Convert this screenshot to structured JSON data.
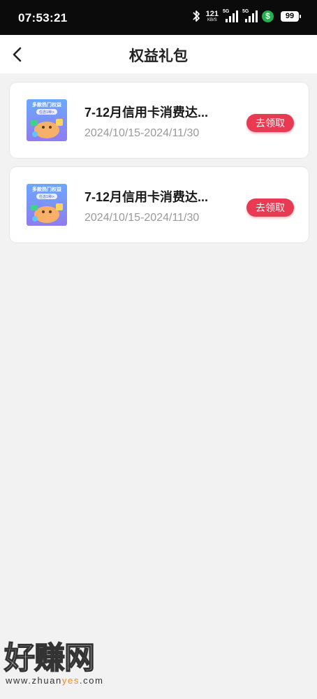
{
  "status_bar": {
    "time": "07:53:21",
    "net_speed_value": "121",
    "net_speed_unit": "KB/S",
    "sim1_label": "5G",
    "sim2_label": "5G",
    "battery": "99"
  },
  "header": {
    "title": "权益礼包"
  },
  "items": [
    {
      "thumb_text_1": "多款热门权益",
      "thumb_text_2": "任选1种>",
      "title": "7-12月信用卡消费达...",
      "date_range": "2024/10/15-2024/11/30",
      "button_label": "去领取"
    },
    {
      "thumb_text_1": "多款热门权益",
      "thumb_text_2": "任选1种>",
      "title": "7-12月信用卡消费达...",
      "date_range": "2024/10/15-2024/11/30",
      "button_label": "去领取"
    }
  ],
  "watermark": {
    "text": "好赚网",
    "url_prefix": "www.zhuan",
    "url_highlight": "yes",
    "url_suffix": ".com"
  },
  "colors": {
    "accent": "#e83a52",
    "status_bar_bg": "#0b0b0b",
    "page_bg": "#f2f2f2"
  }
}
